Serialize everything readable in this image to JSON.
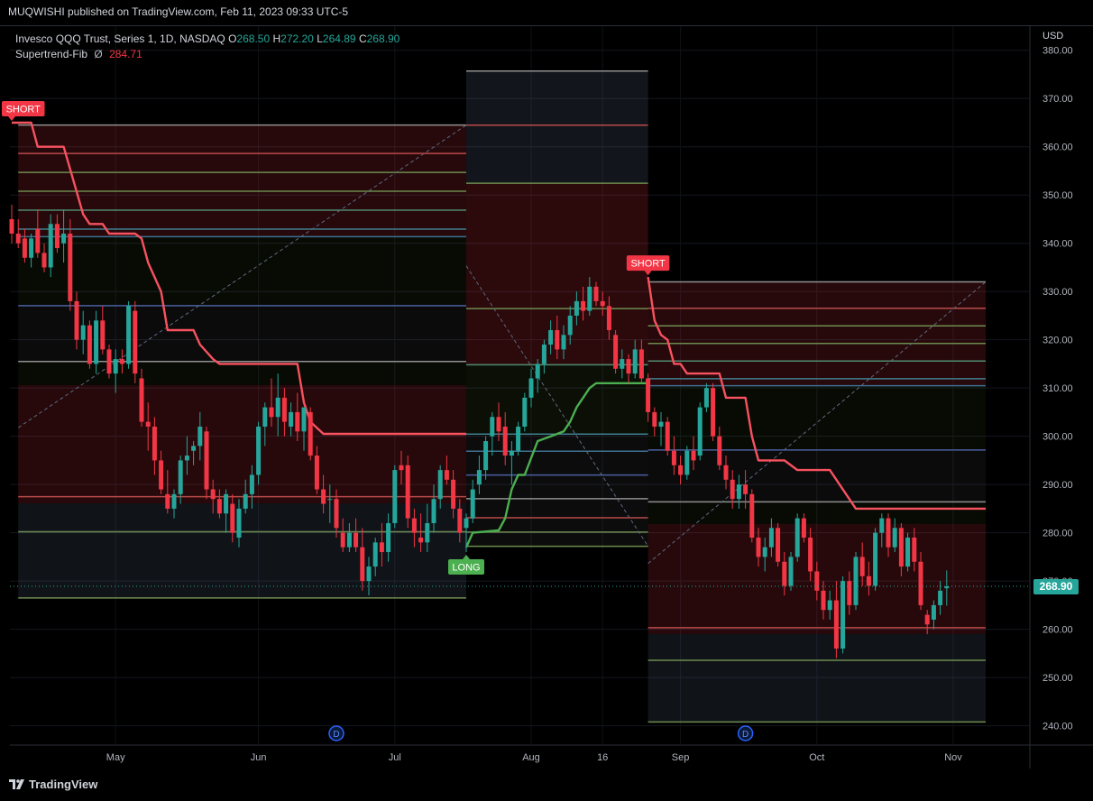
{
  "header": {
    "published": "MUQWISHI published on TradingView.com, Feb 11, 2023 09:33 UTC-5"
  },
  "legend": {
    "symbol": "Invesco QQQ Trust, Series 1, 1D, NASDAQ",
    "o_label": "O",
    "o_value": "268.50",
    "h_label": "H",
    "h_value": "272.20",
    "l_label": "L",
    "l_value": "264.89",
    "c_label": "C",
    "c_value": "268.90",
    "indicator_name": "Supertrend-Fib",
    "indicator_icon": "Ø",
    "indicator_value": "284.71"
  },
  "axis": {
    "currency": "USD"
  },
  "price_tag": "268.90",
  "branding": {
    "logo_text": "TradingView"
  },
  "colors": {
    "up": "#26a69a",
    "down": "#f23645",
    "supertrend_down": "#f7525f",
    "supertrend_up": "#4caf50",
    "background": "#000000",
    "grid": "#1e222d"
  },
  "chart_data": {
    "type": "candlestick",
    "ylim": [
      236,
      385
    ],
    "yticks": [
      "380.00",
      "370.00",
      "360.00",
      "350.00",
      "340.00",
      "330.00",
      "320.00",
      "310.00",
      "300.00",
      "290.00",
      "280.00",
      "270.00",
      "260.00",
      "250.00",
      "240.00"
    ],
    "xticks": [
      {
        "label": "May",
        "i": 16
      },
      {
        "label": "Jun",
        "i": 38
      },
      {
        "label": "Jul",
        "i": 59
      },
      {
        "label": "Aug",
        "i": 80
      },
      {
        "label": "16",
        "i": 91
      },
      {
        "label": "Sep",
        "i": 103
      },
      {
        "label": "Oct",
        "i": 124
      },
      {
        "label": "Nov",
        "i": 145
      }
    ],
    "dividend_markers": [
      {
        "label": "D",
        "i": 50
      },
      {
        "label": "D",
        "i": 113
      }
    ],
    "signals": [
      {
        "label": "SHORT",
        "i": 0,
        "price": 365,
        "type": "short"
      },
      {
        "label": "LONG",
        "i": 70,
        "price": 276,
        "type": "long"
      },
      {
        "label": "SHORT",
        "i": 98,
        "price": 333,
        "type": "short"
      }
    ],
    "fib_zones": [
      {
        "i0": 1,
        "i1": 70,
        "high": 364.5,
        "low": 266.5,
        "direction": "short"
      },
      {
        "i0": 70,
        "i1": 98,
        "high": 375.7,
        "low": 277.2,
        "direction": "long"
      },
      {
        "i0": 98,
        "i1": 150,
        "high": 332,
        "low": 240.8,
        "direction": "short"
      }
    ],
    "supertrend": [
      {
        "i": 0,
        "v": 365
      },
      {
        "i": 3,
        "v": 365
      },
      {
        "i": 4,
        "v": 360
      },
      {
        "i": 8,
        "v": 360
      },
      {
        "i": 11,
        "v": 346
      },
      {
        "i": 12,
        "v": 344
      },
      {
        "i": 14,
        "v": 344
      },
      {
        "i": 15,
        "v": 342
      },
      {
        "i": 19,
        "v": 342
      },
      {
        "i": 20,
        "v": 341
      },
      {
        "i": 21,
        "v": 336
      },
      {
        "i": 23,
        "v": 330
      },
      {
        "i": 24,
        "v": 322
      },
      {
        "i": 28,
        "v": 322
      },
      {
        "i": 29,
        "v": 319
      },
      {
        "i": 31,
        "v": 316
      },
      {
        "i": 32,
        "v": 315
      },
      {
        "i": 44,
        "v": 315
      },
      {
        "i": 45,
        "v": 307
      },
      {
        "i": 46,
        "v": 303
      },
      {
        "i": 48,
        "v": 300.5
      },
      {
        "i": 70,
        "v": 300.5
      },
      {
        "i": 70,
        "v": 277
      },
      {
        "i": 71,
        "v": 280
      },
      {
        "i": 75,
        "v": 280.5
      },
      {
        "i": 76,
        "v": 283
      },
      {
        "i": 77,
        "v": 289
      },
      {
        "i": 78,
        "v": 292
      },
      {
        "i": 79,
        "v": 292
      },
      {
        "i": 81,
        "v": 299
      },
      {
        "i": 83,
        "v": 300
      },
      {
        "i": 85,
        "v": 301
      },
      {
        "i": 86,
        "v": 303
      },
      {
        "i": 87,
        "v": 306
      },
      {
        "i": 88,
        "v": 308
      },
      {
        "i": 89,
        "v": 310
      },
      {
        "i": 90,
        "v": 311
      },
      {
        "i": 98,
        "v": 311
      },
      {
        "i": 98,
        "v": 333
      },
      {
        "i": 99,
        "v": 324
      },
      {
        "i": 100,
        "v": 321
      },
      {
        "i": 101,
        "v": 320
      },
      {
        "i": 102,
        "v": 315
      },
      {
        "i": 103,
        "v": 315
      },
      {
        "i": 104,
        "v": 313
      },
      {
        "i": 109,
        "v": 313
      },
      {
        "i": 110,
        "v": 308
      },
      {
        "i": 113,
        "v": 308
      },
      {
        "i": 114,
        "v": 300
      },
      {
        "i": 115,
        "v": 295
      },
      {
        "i": 119,
        "v": 295
      },
      {
        "i": 121,
        "v": 293
      },
      {
        "i": 126,
        "v": 293
      },
      {
        "i": 127,
        "v": 291
      },
      {
        "i": 129,
        "v": 287
      },
      {
        "i": 130,
        "v": 285
      },
      {
        "i": 150,
        "v": 285
      }
    ],
    "candles": [
      {
        "o": 345,
        "h": 348,
        "l": 340,
        "c": 342
      },
      {
        "o": 342,
        "h": 345,
        "l": 339,
        "c": 340
      },
      {
        "o": 341,
        "h": 343,
        "l": 336,
        "c": 337
      },
      {
        "o": 337,
        "h": 342,
        "l": 335,
        "c": 341
      },
      {
        "o": 343,
        "h": 347,
        "l": 337,
        "c": 338
      },
      {
        "o": 338,
        "h": 340,
        "l": 334,
        "c": 335
      },
      {
        "o": 335,
        "h": 346,
        "l": 333,
        "c": 344
      },
      {
        "o": 344,
        "h": 346,
        "l": 338,
        "c": 339
      },
      {
        "o": 340,
        "h": 347,
        "l": 336,
        "c": 342
      },
      {
        "o": 342,
        "h": 345,
        "l": 326,
        "c": 328
      },
      {
        "o": 328,
        "h": 330,
        "l": 318,
        "c": 320
      },
      {
        "o": 320,
        "h": 326,
        "l": 317,
        "c": 323
      },
      {
        "o": 323,
        "h": 324,
        "l": 314,
        "c": 315
      },
      {
        "o": 315,
        "h": 326,
        "l": 313,
        "c": 324
      },
      {
        "o": 324,
        "h": 327,
        "l": 317,
        "c": 318
      },
      {
        "o": 318,
        "h": 319,
        "l": 312,
        "c": 313
      },
      {
        "o": 313,
        "h": 318,
        "l": 309,
        "c": 316
      },
      {
        "o": 316,
        "h": 318,
        "l": 313,
        "c": 315
      },
      {
        "o": 315,
        "h": 328,
        "l": 314,
        "c": 327
      },
      {
        "o": 326,
        "h": 328,
        "l": 311,
        "c": 313
      },
      {
        "o": 312,
        "h": 314,
        "l": 302,
        "c": 303
      },
      {
        "o": 303,
        "h": 307,
        "l": 297,
        "c": 302
      },
      {
        "o": 302,
        "h": 304,
        "l": 292,
        "c": 295
      },
      {
        "o": 295,
        "h": 297,
        "l": 288,
        "c": 289
      },
      {
        "o": 288,
        "h": 293,
        "l": 284,
        "c": 285
      },
      {
        "o": 285,
        "h": 289,
        "l": 283,
        "c": 288
      },
      {
        "o": 288,
        "h": 296,
        "l": 286,
        "c": 295
      },
      {
        "o": 295,
        "h": 300,
        "l": 292,
        "c": 296
      },
      {
        "o": 297,
        "h": 299,
        "l": 294,
        "c": 298
      },
      {
        "o": 298,
        "h": 305,
        "l": 295,
        "c": 302
      },
      {
        "o": 301,
        "h": 302,
        "l": 287,
        "c": 289
      },
      {
        "o": 289,
        "h": 291,
        "l": 284,
        "c": 287
      },
      {
        "o": 287,
        "h": 289,
        "l": 283,
        "c": 284
      },
      {
        "o": 284,
        "h": 289,
        "l": 280,
        "c": 288
      },
      {
        "o": 286,
        "h": 288,
        "l": 278,
        "c": 280
      },
      {
        "o": 279,
        "h": 287,
        "l": 277,
        "c": 285
      },
      {
        "o": 285,
        "h": 291,
        "l": 284,
        "c": 288
      },
      {
        "o": 288,
        "h": 294,
        "l": 285,
        "c": 292
      },
      {
        "o": 292,
        "h": 303,
        "l": 290,
        "c": 302
      },
      {
        "o": 302,
        "h": 307,
        "l": 298,
        "c": 306
      },
      {
        "o": 306,
        "h": 312,
        "l": 302,
        "c": 304
      },
      {
        "o": 304,
        "h": 313,
        "l": 300,
        "c": 308
      },
      {
        "o": 308,
        "h": 310,
        "l": 300,
        "c": 303
      },
      {
        "o": 302,
        "h": 307,
        "l": 300,
        "c": 305
      },
      {
        "o": 305,
        "h": 309,
        "l": 299,
        "c": 301
      },
      {
        "o": 301,
        "h": 306,
        "l": 297,
        "c": 306
      },
      {
        "o": 305,
        "h": 306,
        "l": 295,
        "c": 296
      },
      {
        "o": 296,
        "h": 298,
        "l": 288,
        "c": 289
      },
      {
        "o": 289,
        "h": 292,
        "l": 284,
        "c": 286
      },
      {
        "o": 287,
        "h": 290,
        "l": 282,
        "c": 287
      },
      {
        "o": 287,
        "h": 289,
        "l": 279,
        "c": 281
      },
      {
        "o": 280,
        "h": 283,
        "l": 276,
        "c": 277
      },
      {
        "o": 277,
        "h": 282,
        "l": 276,
        "c": 280
      },
      {
        "o": 280,
        "h": 283,
        "l": 276,
        "c": 277
      },
      {
        "o": 277,
        "h": 281,
        "l": 268,
        "c": 270
      },
      {
        "o": 270,
        "h": 275,
        "l": 267,
        "c": 273
      },
      {
        "o": 273,
        "h": 279,
        "l": 271,
        "c": 278
      },
      {
        "o": 278,
        "h": 282,
        "l": 273,
        "c": 276
      },
      {
        "o": 276,
        "h": 284,
        "l": 274,
        "c": 282
      },
      {
        "o": 282,
        "h": 294,
        "l": 281,
        "c": 293
      },
      {
        "o": 294,
        "h": 297,
        "l": 290,
        "c": 293
      },
      {
        "o": 294,
        "h": 296,
        "l": 281,
        "c": 283
      },
      {
        "o": 283,
        "h": 285,
        "l": 277,
        "c": 280
      },
      {
        "o": 279,
        "h": 284,
        "l": 276,
        "c": 278
      },
      {
        "o": 278,
        "h": 286,
        "l": 276,
        "c": 282
      },
      {
        "o": 282,
        "h": 290,
        "l": 280,
        "c": 287
      },
      {
        "o": 287,
        "h": 294,
        "l": 285,
        "c": 293
      },
      {
        "o": 293,
        "h": 296,
        "l": 290,
        "c": 291
      },
      {
        "o": 291,
        "h": 293,
        "l": 283,
        "c": 285
      },
      {
        "o": 285,
        "h": 287,
        "l": 278,
        "c": 280
      },
      {
        "o": 281,
        "h": 284,
        "l": 276,
        "c": 283
      },
      {
        "o": 283,
        "h": 291,
        "l": 282,
        "c": 289
      },
      {
        "o": 290,
        "h": 296,
        "l": 288,
        "c": 293
      },
      {
        "o": 293,
        "h": 300,
        "l": 291,
        "c": 299
      },
      {
        "o": 300,
        "h": 305,
        "l": 296,
        "c": 304
      },
      {
        "o": 304,
        "h": 307,
        "l": 299,
        "c": 301
      },
      {
        "o": 302,
        "h": 305,
        "l": 294,
        "c": 296
      },
      {
        "o": 296,
        "h": 299,
        "l": 290,
        "c": 297
      },
      {
        "o": 297,
        "h": 303,
        "l": 296,
        "c": 302
      },
      {
        "o": 302,
        "h": 309,
        "l": 301,
        "c": 308
      },
      {
        "o": 308,
        "h": 314,
        "l": 306,
        "c": 312
      },
      {
        "o": 312,
        "h": 316,
        "l": 309,
        "c": 315
      },
      {
        "o": 315,
        "h": 320,
        "l": 313,
        "c": 319
      },
      {
        "o": 319,
        "h": 324,
        "l": 317,
        "c": 322
      },
      {
        "o": 322,
        "h": 325,
        "l": 316,
        "c": 318
      },
      {
        "o": 318,
        "h": 323,
        "l": 316,
        "c": 321
      },
      {
        "o": 321,
        "h": 327,
        "l": 319,
        "c": 325
      },
      {
        "o": 325,
        "h": 330,
        "l": 323,
        "c": 328
      },
      {
        "o": 328,
        "h": 331,
        "l": 324,
        "c": 326
      },
      {
        "o": 326,
        "h": 333,
        "l": 325,
        "c": 331
      },
      {
        "o": 331,
        "h": 332,
        "l": 327,
        "c": 328
      },
      {
        "o": 328,
        "h": 330,
        "l": 325,
        "c": 327
      },
      {
        "o": 327,
        "h": 329,
        "l": 320,
        "c": 322
      },
      {
        "o": 321,
        "h": 322,
        "l": 313,
        "c": 314
      },
      {
        "o": 314,
        "h": 318,
        "l": 312,
        "c": 316
      },
      {
        "o": 316,
        "h": 317,
        "l": 311,
        "c": 313
      },
      {
        "o": 313,
        "h": 320,
        "l": 312,
        "c": 318
      },
      {
        "o": 318,
        "h": 320,
        "l": 311,
        "c": 312
      },
      {
        "o": 312,
        "h": 313,
        "l": 303,
        "c": 305
      },
      {
        "o": 305,
        "h": 306,
        "l": 300,
        "c": 302
      },
      {
        "o": 302,
        "h": 305,
        "l": 298,
        "c": 303
      },
      {
        "o": 303,
        "h": 304,
        "l": 296,
        "c": 297
      },
      {
        "o": 297,
        "h": 300,
        "l": 292,
        "c": 294
      },
      {
        "o": 294,
        "h": 296,
        "l": 290,
        "c": 292
      },
      {
        "o": 292,
        "h": 298,
        "l": 291,
        "c": 297
      },
      {
        "o": 297,
        "h": 300,
        "l": 293,
        "c": 295
      },
      {
        "o": 296,
        "h": 307,
        "l": 295,
        "c": 306
      },
      {
        "o": 306,
        "h": 311,
        "l": 305,
        "c": 310
      },
      {
        "o": 310,
        "h": 311,
        "l": 299,
        "c": 300
      },
      {
        "o": 300,
        "h": 302,
        "l": 293,
        "c": 294
      },
      {
        "o": 294,
        "h": 296,
        "l": 289,
        "c": 291
      },
      {
        "o": 291,
        "h": 293,
        "l": 285,
        "c": 287
      },
      {
        "o": 287,
        "h": 292,
        "l": 285,
        "c": 290
      },
      {
        "o": 290,
        "h": 293,
        "l": 285,
        "c": 288
      },
      {
        "o": 288,
        "h": 289,
        "l": 278,
        "c": 279
      },
      {
        "o": 279,
        "h": 281,
        "l": 273,
        "c": 275
      },
      {
        "o": 275,
        "h": 279,
        "l": 272,
        "c": 277
      },
      {
        "o": 277,
        "h": 283,
        "l": 275,
        "c": 281
      },
      {
        "o": 281,
        "h": 282,
        "l": 273,
        "c": 274
      },
      {
        "o": 274,
        "h": 276,
        "l": 267,
        "c": 269
      },
      {
        "o": 269,
        "h": 276,
        "l": 268,
        "c": 275
      },
      {
        "o": 275,
        "h": 284,
        "l": 274,
        "c": 283
      },
      {
        "o": 283,
        "h": 284,
        "l": 278,
        "c": 279
      },
      {
        "o": 279,
        "h": 281,
        "l": 270,
        "c": 272
      },
      {
        "o": 272,
        "h": 274,
        "l": 266,
        "c": 268
      },
      {
        "o": 268,
        "h": 270,
        "l": 262,
        "c": 264
      },
      {
        "o": 264,
        "h": 268,
        "l": 262,
        "c": 266
      },
      {
        "o": 266,
        "h": 270,
        "l": 254,
        "c": 256
      },
      {
        "o": 256,
        "h": 271,
        "l": 255,
        "c": 270
      },
      {
        "o": 270,
        "h": 272,
        "l": 263,
        "c": 265
      },
      {
        "o": 265,
        "h": 276,
        "l": 264,
        "c": 275
      },
      {
        "o": 275,
        "h": 278,
        "l": 269,
        "c": 271
      },
      {
        "o": 271,
        "h": 274,
        "l": 267,
        "c": 269
      },
      {
        "o": 269,
        "h": 281,
        "l": 268,
        "c": 280
      },
      {
        "o": 280,
        "h": 284,
        "l": 277,
        "c": 283
      },
      {
        "o": 283,
        "h": 284,
        "l": 275,
        "c": 277
      },
      {
        "o": 277,
        "h": 283,
        "l": 276,
        "c": 281
      },
      {
        "o": 281,
        "h": 282,
        "l": 271,
        "c": 273
      },
      {
        "o": 273,
        "h": 280,
        "l": 272,
        "c": 279
      },
      {
        "o": 279,
        "h": 281,
        "l": 272,
        "c": 274
      },
      {
        "o": 274,
        "h": 276,
        "l": 264,
        "c": 265
      },
      {
        "o": 263,
        "h": 264,
        "l": 259,
        "c": 261
      },
      {
        "o": 262,
        "h": 266,
        "l": 260,
        "c": 265
      },
      {
        "o": 265,
        "h": 270,
        "l": 263,
        "c": 268
      },
      {
        "o": 268.5,
        "h": 272.2,
        "l": 264.89,
        "c": 268.9
      }
    ]
  }
}
